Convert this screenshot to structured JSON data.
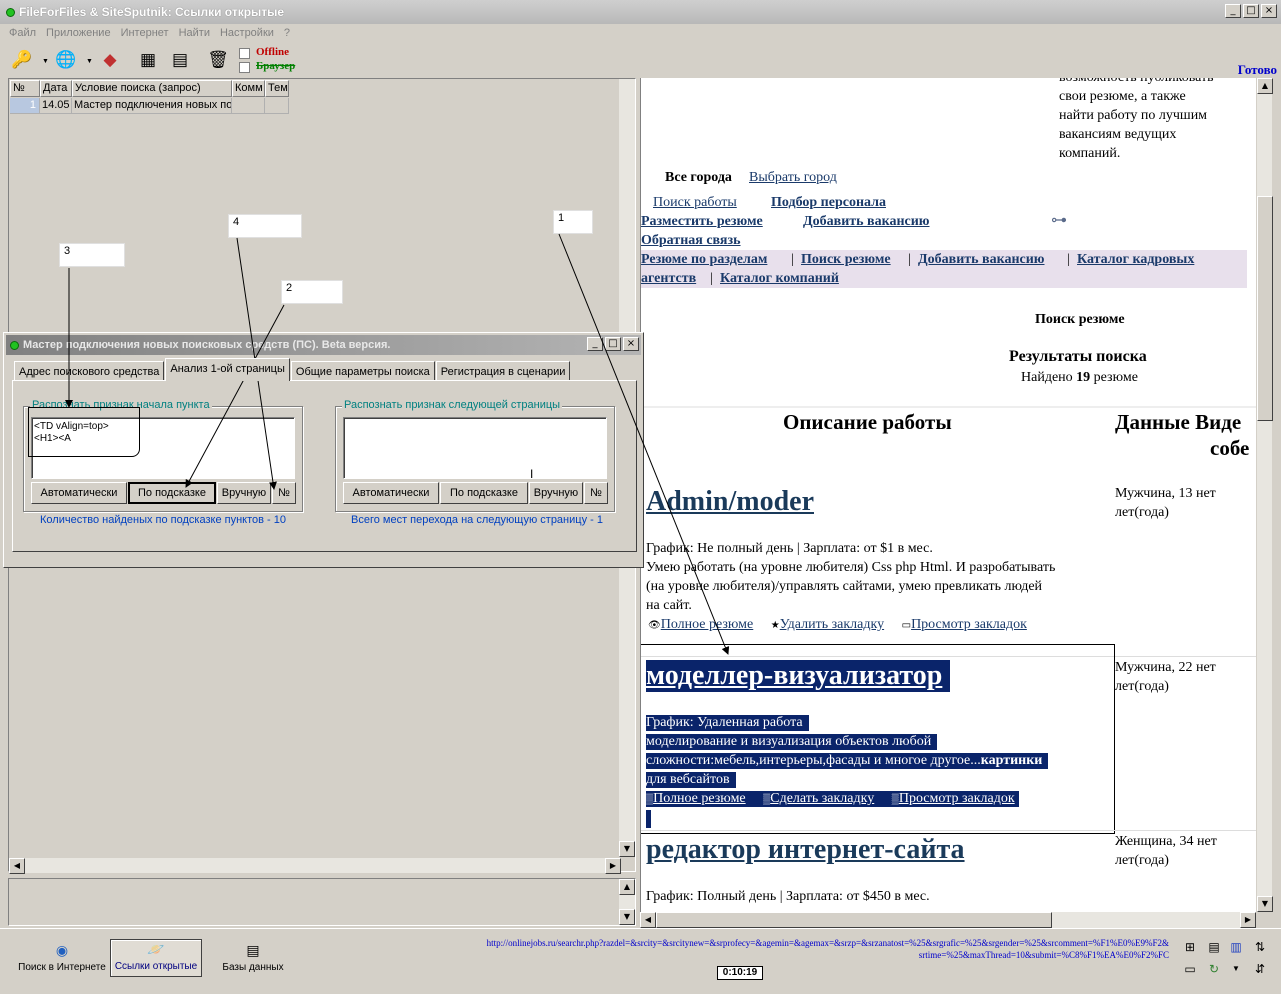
{
  "window": {
    "title": "FileForFiles & SiteSputnik: Ссылки открытые",
    "controls": [
      "_",
      "□",
      "×"
    ]
  },
  "menu": [
    "Файл",
    "Приложение",
    "Интернет",
    "Найти",
    "Настройки",
    "?"
  ],
  "toolbar": {
    "offline_label": "Offline",
    "browser_label": "Браузер",
    "status": "Готово"
  },
  "grid": {
    "headers": [
      "№",
      "Дата",
      "Условие поиска (запрос)",
      "Комм",
      "Тем"
    ],
    "rows": [
      {
        "num": "1",
        "date": "14.05",
        "query": "Мастер подключения новых по",
        "comm": "",
        "theme": ""
      }
    ]
  },
  "annotations": [
    "1",
    "2",
    "3",
    "4"
  ],
  "dialog": {
    "title": "Мастер подключения новых поисковых средств (ПС). Beta версия.",
    "tabs": [
      "Адрес поискового средства",
      "Анализ 1-ой страницы",
      "Общие параметры поиска",
      "Регистрация в сценарии"
    ],
    "left_group": {
      "label": "Распознать признак начала пункта",
      "memo_line1": "<TD vAlign=top>",
      "memo_line2": "<H1><A",
      "buttons": [
        "Автоматически",
        "По подсказке",
        "Вручную",
        "№"
      ],
      "count": "Количество найденых по подсказке пунктов - 10"
    },
    "right_group": {
      "label": "Распознать признак следующей страницы",
      "buttons": [
        "Автоматически",
        "По подсказке",
        "Вручную",
        "№"
      ],
      "count": "Всего мест перехода на следующую страницу - 1"
    }
  },
  "browser": {
    "intro_lines": [
      "возможность публиковать",
      "свои резюме, а также",
      "найти работу по лучшим",
      "вакансиям ведущих",
      "компаний."
    ],
    "all_cities": "Все города",
    "choose_city": "Выбрать город",
    "job_search": "Поиск работы",
    "staff_search": "Подбор персонала",
    "post_resume": "Разместить резюме",
    "add_vacancy": "Добавить вакансию",
    "feedback": "Обратная связь",
    "menu": [
      "Резюме по разделам",
      "Поиск резюме",
      "Добавить вакансию",
      "Каталог кадровых",
      "агентств",
      "Каталог компаний"
    ],
    "search_heading": "Поиск резюме",
    "results_heading": "Результаты поиска",
    "found_prefix": "Найдено",
    "found_count": "19",
    "found_suffix": "резюме",
    "col_desc": "Описание работы",
    "col_data": "Данные Виде",
    "col_data2": "собе",
    "jobs": [
      {
        "title": "Admin/moder",
        "lines": [
          "График: Не полный день | Зарплата: от $1 в мес.",
          "Умею работать (на уровне любителя) Css php Html. И разробатывать",
          "(на уровне любителя)/управлять сайтами, умею превликать людей",
          "на сайт."
        ],
        "links": [
          "Полное резюме",
          "Удалить закладку",
          "Просмотр закладок"
        ],
        "info": [
          "Мужчина, 13 нет",
          "лет(года)"
        ]
      },
      {
        "title": "моделлер-визуализатор",
        "lines": [
          "График: Удаленная работа",
          "моделирование и визуализация объектов любой",
          "сложности:мебель,интерьеры,фасады и многое другое...",
          "картинки",
          "для вебсайтов"
        ],
        "links": [
          "Полное резюме",
          "Сделать закладку",
          "Просмотр закладок"
        ],
        "info": [
          "Мужчина, 22 нет",
          "лет(года)"
        ]
      },
      {
        "title": "редактор интернет-сайта",
        "lines": [
          "График: Полный день | Зарплата: от $450 в мес."
        ],
        "info": [
          "Женщина, 34 нет",
          "лет(года)"
        ]
      }
    ]
  },
  "bottom": {
    "nav": [
      "Поиск в Интернете",
      "Ссылки открытые",
      "Базы данных"
    ],
    "url_line1": "http://onlinejobs.ru/searchr.php?razdel=&srcity=&srcitynew=&srprofecy=&agemin=&agemax=&srzp=&srzanatost=%25&srgrafic=%25&srgender=%25&srcomment=%F1%E0%E9%F2&",
    "url_line2": "srtime=%25&maxThread=10&submit=%C8%F1%EA%E0%F2%FC",
    "timer": "0:10:19"
  }
}
